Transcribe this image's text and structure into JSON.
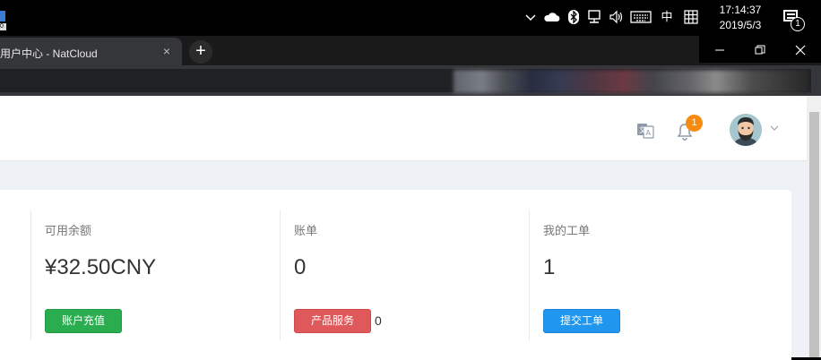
{
  "taskbar": {
    "app_badge": "0",
    "ime": "中",
    "time": "17:14:37",
    "date": "2019/5/3",
    "notification_count": "1",
    "icons": [
      "chevron-up-icon",
      "onedrive-cloud-icon",
      "bluetooth-icon",
      "network-icon",
      "volume-icon",
      "keyboard-icon",
      "ime-grid-icon"
    ]
  },
  "browser": {
    "tab_title": "用户中心 - NatCloud",
    "tab_close": "×",
    "new_tab": "+",
    "window_controls": {
      "minimize": "—",
      "restore": "❐",
      "close": "✕"
    }
  },
  "header": {
    "notification_badge": "1",
    "icons": [
      "translate-icon",
      "bell-icon",
      "avatar",
      "chevron-down-icon"
    ]
  },
  "stats": [
    {
      "label": "可用余额",
      "value": "¥32.50CNY",
      "button": "账户充值",
      "button_color": "#2aad4f"
    },
    {
      "label": "账单",
      "value": "0",
      "button": "产品服务",
      "button_color": "#e0595a",
      "side_text": "0"
    },
    {
      "label": "我的工单",
      "value": "1",
      "button": "提交工单",
      "button_color": "#2196ee"
    }
  ]
}
